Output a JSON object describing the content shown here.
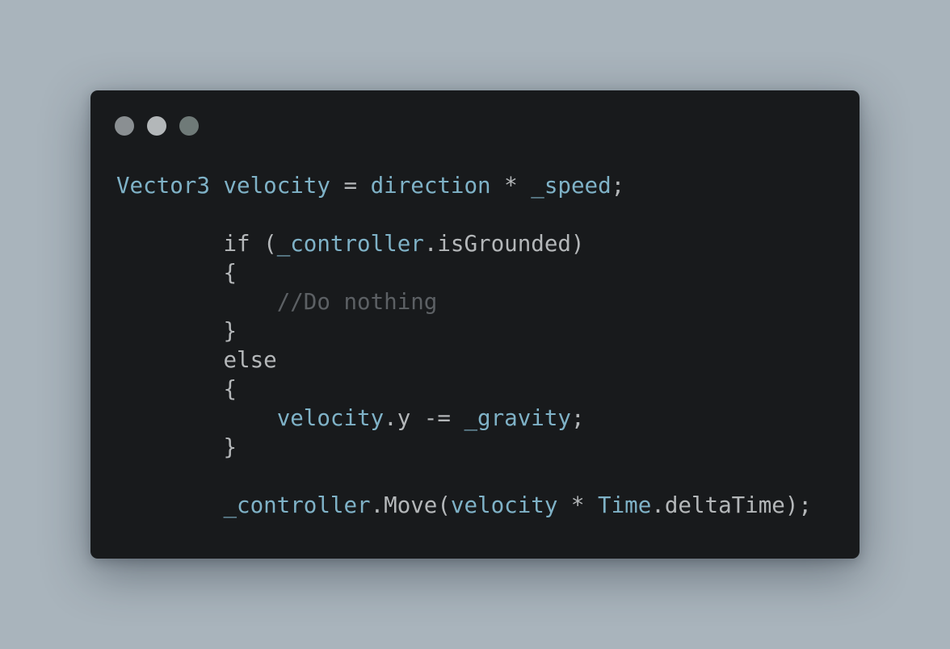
{
  "window": {
    "controls": [
      {
        "name": "close",
        "color": "#8a8f92"
      },
      {
        "name": "minimize",
        "color": "#b3b7b9"
      },
      {
        "name": "maximize",
        "color": "#6f7a78"
      }
    ]
  },
  "code": {
    "lines": [
      [
        {
          "t": "Vector3",
          "k": "ident"
        },
        {
          "t": " ",
          "k": "plain"
        },
        {
          "t": "velocity",
          "k": "ident"
        },
        {
          "t": " = ",
          "k": "plain"
        },
        {
          "t": "direction",
          "k": "ident"
        },
        {
          "t": " * ",
          "k": "plain"
        },
        {
          "t": "_speed",
          "k": "ident"
        },
        {
          "t": ";",
          "k": "plain"
        }
      ],
      [],
      [
        {
          "t": "        if (",
          "k": "plain"
        },
        {
          "t": "_controller",
          "k": "ident"
        },
        {
          "t": ".isGrounded)",
          "k": "plain"
        }
      ],
      [
        {
          "t": "        {",
          "k": "plain"
        }
      ],
      [
        {
          "t": "            ",
          "k": "plain"
        },
        {
          "t": "//Do nothing",
          "k": "comment"
        }
      ],
      [
        {
          "t": "        }",
          "k": "plain"
        }
      ],
      [
        {
          "t": "        else",
          "k": "plain"
        }
      ],
      [
        {
          "t": "        {",
          "k": "plain"
        }
      ],
      [
        {
          "t": "            ",
          "k": "plain"
        },
        {
          "t": "velocity",
          "k": "ident"
        },
        {
          "t": ".y -= ",
          "k": "plain"
        },
        {
          "t": "_gravity",
          "k": "ident"
        },
        {
          "t": ";",
          "k": "plain"
        }
      ],
      [
        {
          "t": "        }",
          "k": "plain"
        }
      ],
      [],
      [
        {
          "t": "        ",
          "k": "plain"
        },
        {
          "t": "_controller",
          "k": "ident"
        },
        {
          "t": ".Move(",
          "k": "plain"
        },
        {
          "t": "velocity",
          "k": "ident"
        },
        {
          "t": " * ",
          "k": "plain"
        },
        {
          "t": "Time",
          "k": "ident"
        },
        {
          "t": ".deltaTime);",
          "k": "plain"
        }
      ]
    ]
  }
}
